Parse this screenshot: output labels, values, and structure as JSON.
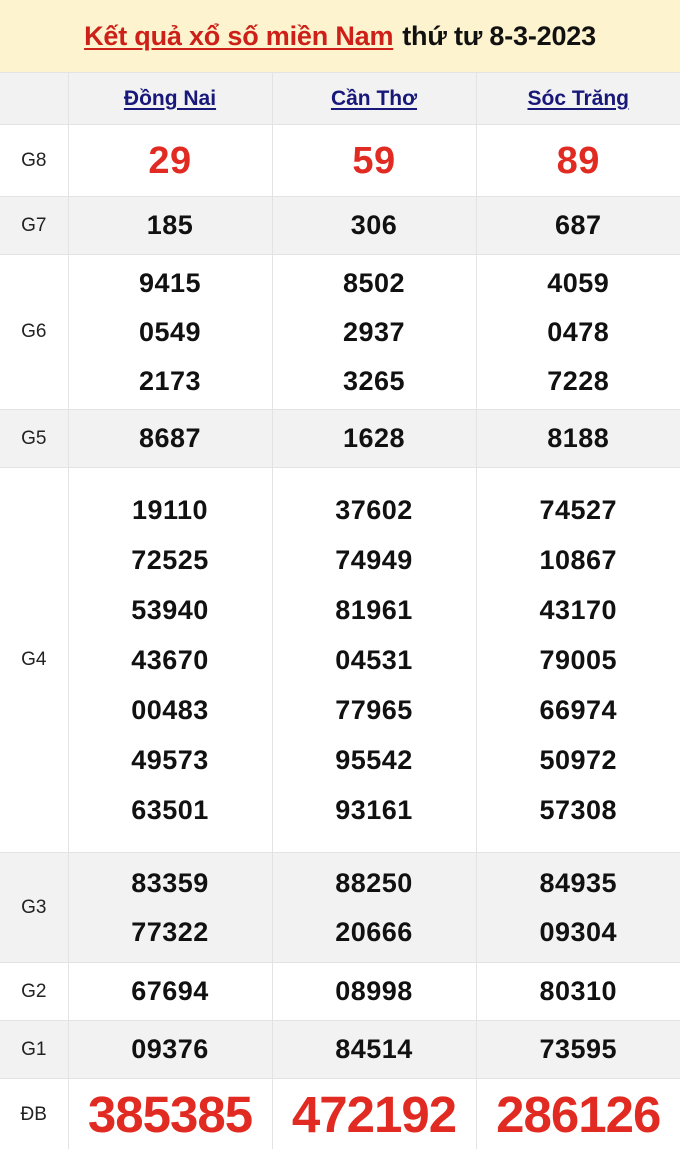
{
  "header": {
    "title_main": "Kết quả xổ số miền Nam",
    "title_date": "thứ tư 8-3-2023",
    "title_color": "#cc2018",
    "date_color": "#111111",
    "banner_background": "#fdf3cf"
  },
  "table": {
    "province_header_color": "#18177a",
    "highlight_color": "#e12b22",
    "row_label_header": "",
    "provinces": [
      "Đồng Nai",
      "Cần Thơ",
      "Sóc Trăng"
    ],
    "rows": [
      {
        "label": "G8",
        "stripe": "white",
        "highlight": true,
        "values": [
          [
            "29"
          ],
          [
            "59"
          ],
          [
            "89"
          ]
        ]
      },
      {
        "label": "G7",
        "stripe": "gray",
        "highlight": false,
        "values": [
          [
            "185"
          ],
          [
            "306"
          ],
          [
            "687"
          ]
        ]
      },
      {
        "label": "G6",
        "stripe": "white",
        "highlight": false,
        "values": [
          [
            "9415",
            "0549",
            "2173"
          ],
          [
            "8502",
            "2937",
            "3265"
          ],
          [
            "4059",
            "0478",
            "7228"
          ]
        ]
      },
      {
        "label": "G5",
        "stripe": "gray",
        "highlight": false,
        "values": [
          [
            "8687"
          ],
          [
            "1628"
          ],
          [
            "8188"
          ]
        ]
      },
      {
        "label": "G4",
        "stripe": "white",
        "highlight": false,
        "values": [
          [
            "19110",
            "72525",
            "53940",
            "43670",
            "00483",
            "49573",
            "63501"
          ],
          [
            "37602",
            "74949",
            "81961",
            "04531",
            "77965",
            "95542",
            "93161"
          ],
          [
            "74527",
            "10867",
            "43170",
            "79005",
            "66974",
            "50972",
            "57308"
          ]
        ]
      },
      {
        "label": "G3",
        "stripe": "gray",
        "highlight": false,
        "values": [
          [
            "83359",
            "77322"
          ],
          [
            "88250",
            "20666"
          ],
          [
            "84935",
            "09304"
          ]
        ]
      },
      {
        "label": "G2",
        "stripe": "white",
        "highlight": false,
        "values": [
          [
            "67694"
          ],
          [
            "08998"
          ],
          [
            "80310"
          ]
        ]
      },
      {
        "label": "G1",
        "stripe": "gray",
        "highlight": false,
        "values": [
          [
            "09376"
          ],
          [
            "84514"
          ],
          [
            "73595"
          ]
        ]
      },
      {
        "label": "ĐB",
        "stripe": "white",
        "highlight": true,
        "values": [
          [
            "385385"
          ],
          [
            "472192"
          ],
          [
            "286126"
          ]
        ]
      }
    ]
  }
}
